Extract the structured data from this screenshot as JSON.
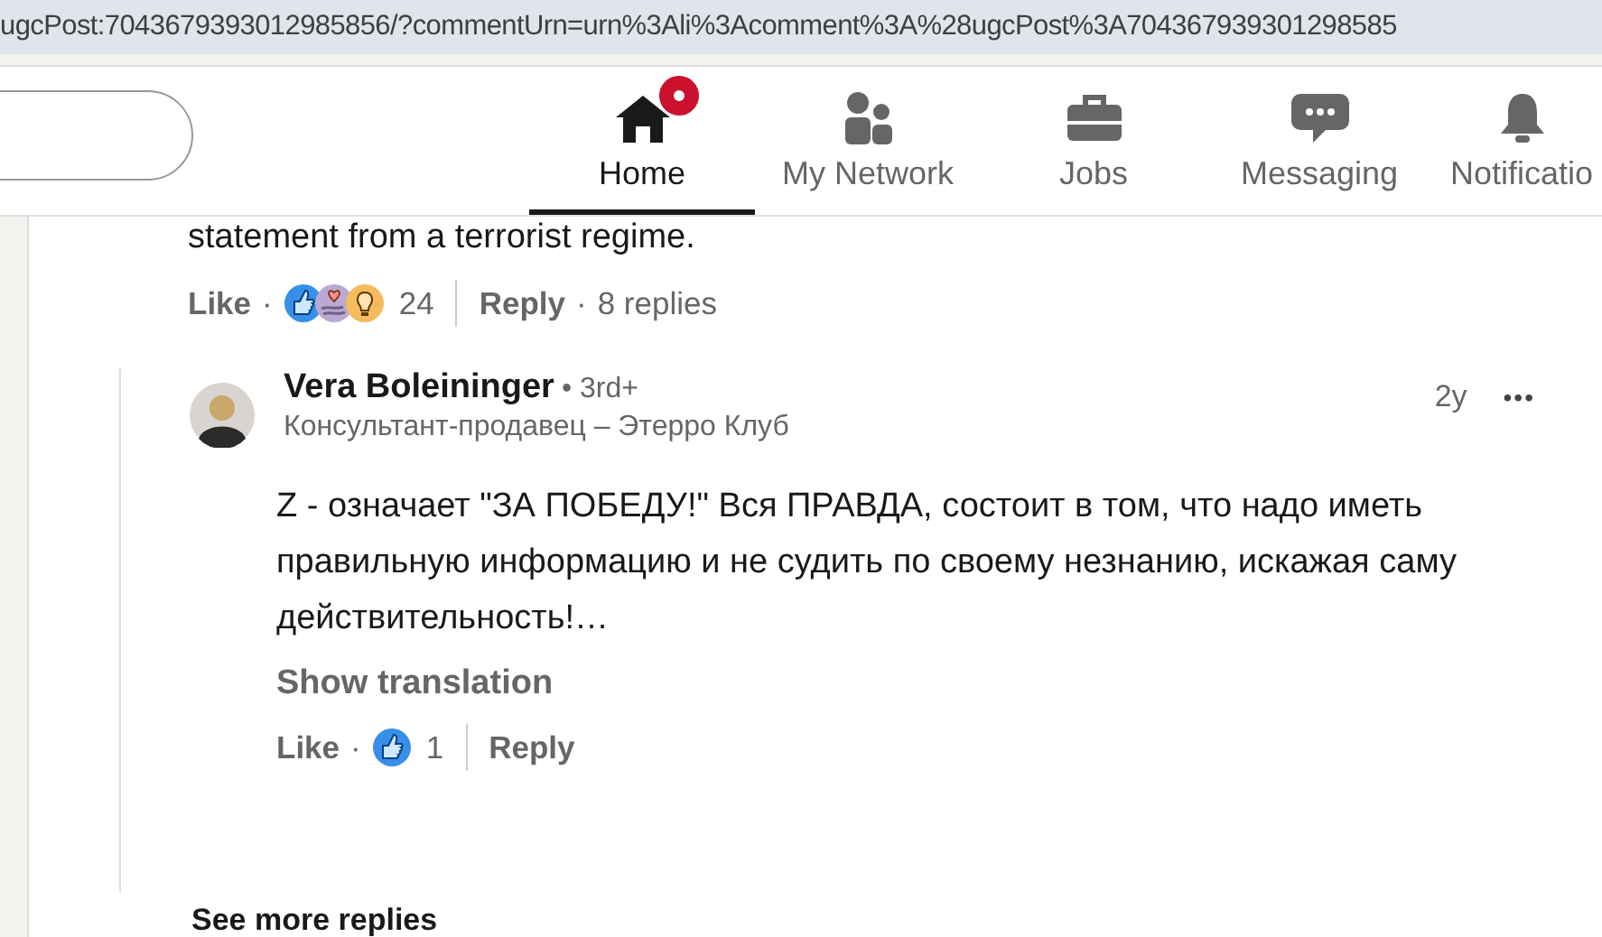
{
  "address_bar": {
    "url": "ugcPost:7043679393012985856/?commentUrn=urn%3Ali%3Acomment%3A%28ugcPost%3A704367939301298585"
  },
  "nav": {
    "items": [
      {
        "kind": "home",
        "label": "Home",
        "selected": true,
        "notification_dot": true
      },
      {
        "kind": "network",
        "label": "My Network",
        "selected": false,
        "notification_dot": false
      },
      {
        "kind": "jobs",
        "label": "Jobs",
        "selected": false,
        "notification_dot": false
      },
      {
        "kind": "messaging",
        "label": "Messaging",
        "selected": false,
        "notification_dot": false
      },
      {
        "kind": "bell",
        "label": "Notificatio",
        "selected": false,
        "notification_dot": false
      }
    ]
  },
  "parent_comment": {
    "text_end": "statement from a terrorist regime.",
    "footer": {
      "like": "Like",
      "separator": "·",
      "reactions": [
        {
          "kind": "like"
        },
        {
          "kind": "support"
        },
        {
          "kind": "insight"
        }
      ],
      "reaction_count": "24",
      "reply": "Reply",
      "replies_separator": "·",
      "replies": "8 replies"
    }
  },
  "reply": {
    "author": "Vera Boleininger",
    "degree": "• 3rd+",
    "headline": "Консультант-продавец – Этерро Клуб",
    "time": "2y",
    "menu": "•••",
    "text": "Z - означает \"ЗА ПОБЕДУ!\" Вся ПРАВДА, состоит в том, что надо иметь правильную информацию и не судить по своему незнанию, искажая саму действительность!…",
    "translate": "Show translation",
    "footer": {
      "like": "Like",
      "separator": "·",
      "reactions": [
        {
          "kind": "like"
        }
      ],
      "reaction_count": "1",
      "reply": "Reply"
    }
  },
  "see_more": "See more replies"
}
